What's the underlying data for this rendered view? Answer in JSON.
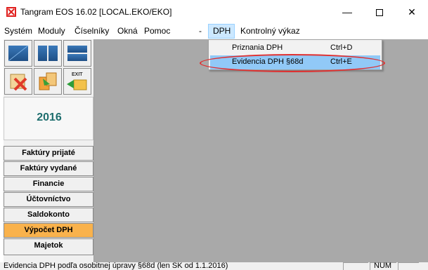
{
  "window": {
    "title": "Tangram EOS 16.02 [LOCAL.EKO/EKO]",
    "minimize": "—",
    "close": "✕"
  },
  "menubar": {
    "items": [
      "Systém",
      "Moduly",
      "Číselníky",
      "Okná",
      "Pomoc",
      "-",
      "DPH",
      "Kontrolný výkaz"
    ]
  },
  "dph_menu": {
    "items": [
      {
        "label": "Priznania DPH",
        "shortcut": "Ctrl+D"
      },
      {
        "label": "Evidencia DPH §68d",
        "shortcut": "Ctrl+E"
      }
    ]
  },
  "toolbar": {
    "icons": [
      "tile-window-icon",
      "split-window-icon",
      "horizontal-window-icon",
      "delete-doc-icon",
      "copy-doc-icon",
      "exit-icon"
    ],
    "exit_label": "EXIT"
  },
  "year": "2016",
  "nav": {
    "items": [
      "Faktúry prijaté",
      "Faktúry vydané",
      "Financie",
      "Účtovníctvo",
      "Saldokonto",
      "Výpočet DPH",
      "Majetok"
    ],
    "active": "Výpočet DPH"
  },
  "status": {
    "text": "Evidencia DPH podľa osobitnej úpravy §68d (len SK od 1.1.2016)",
    "num": "NUM"
  },
  "colors": {
    "workspace": "#a9a9a9",
    "active_nav": "#f9b24c",
    "menu_highlight": "#91c9f7",
    "annotation": "#e03030",
    "year_text": "#1e6e6e"
  }
}
